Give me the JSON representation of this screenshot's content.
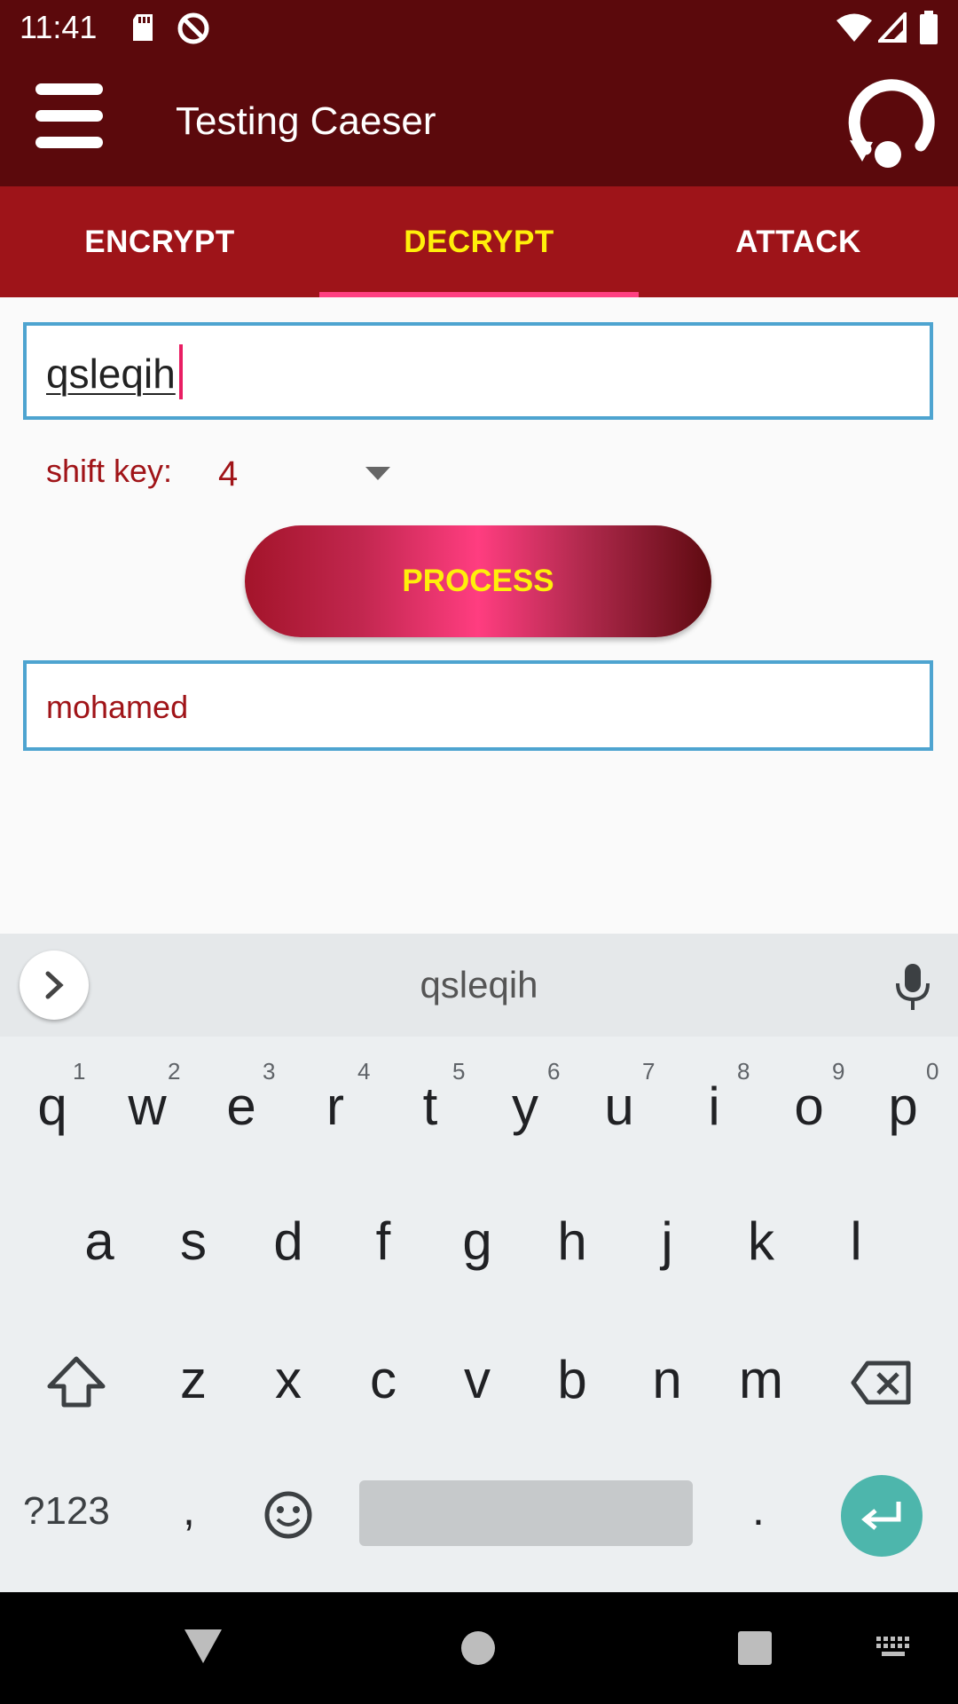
{
  "status_bar": {
    "time": "11:41"
  },
  "app_bar": {
    "title": "Testing Caeser"
  },
  "tabs": [
    {
      "label": "ENCRYPT"
    },
    {
      "label": "DECRYPT"
    },
    {
      "label": "ATTACK"
    }
  ],
  "form": {
    "input_value": "qsleqih",
    "shift_label": "shift key:",
    "shift_value": "4",
    "process_label": "PROCESS",
    "output_value": "mohamed"
  },
  "keyboard": {
    "suggestion": "qsleqih",
    "row1": [
      "q",
      "w",
      "e",
      "r",
      "t",
      "y",
      "u",
      "i",
      "o",
      "p"
    ],
    "row1_nums": [
      "1",
      "2",
      "3",
      "4",
      "5",
      "6",
      "7",
      "8",
      "9",
      "0"
    ],
    "row2": [
      "a",
      "s",
      "d",
      "f",
      "g",
      "h",
      "j",
      "k",
      "l"
    ],
    "row3": [
      "z",
      "x",
      "c",
      "v",
      "b",
      "n",
      "m"
    ],
    "symbols_label": "?123",
    "comma": ",",
    "period": "."
  },
  "colors": {
    "app_bar": "#5b090c",
    "tab_bar": "#9e1419",
    "active_tab": "#ffef0a",
    "indicator": "#ff4081",
    "field_border": "#4ea4d0",
    "accent_text": "#a01418",
    "enter_key": "#4db6ac"
  },
  "icons": [
    "menu-icon",
    "refresh-icon",
    "dropdown-arrow-icon",
    "chevron-right-icon",
    "mic-icon",
    "shift-icon",
    "backspace-icon",
    "emoji-icon",
    "enter-icon",
    "back-icon",
    "home-icon",
    "recents-icon",
    "keyboard-icon",
    "sd-card-icon",
    "no-sync-icon",
    "wifi-icon",
    "signal-icon",
    "battery-icon"
  ]
}
